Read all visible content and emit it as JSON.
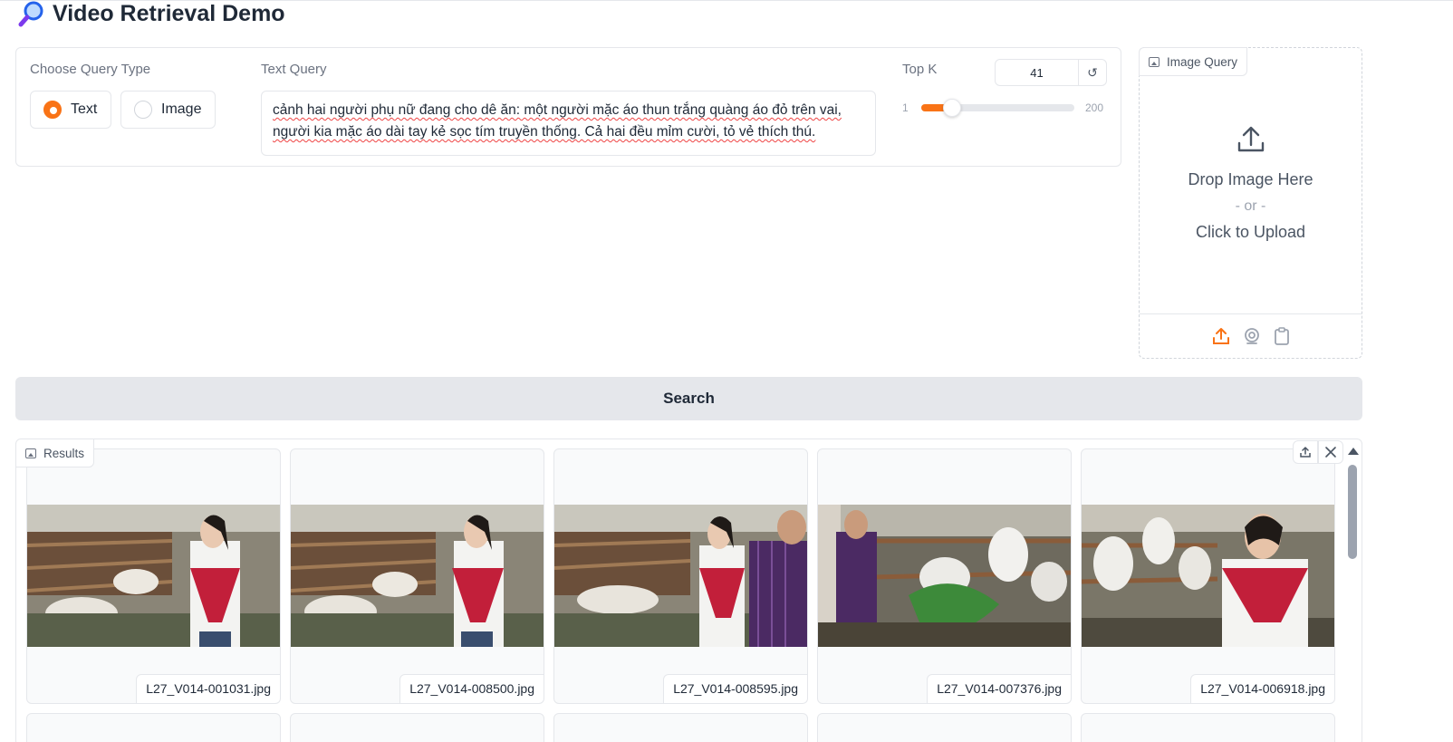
{
  "app": {
    "title": "Video Retrieval Demo",
    "title_icon": "magnifier-icon"
  },
  "query_type": {
    "label": "Choose Query Type",
    "options": [
      "Text",
      "Image"
    ],
    "selected": "Text"
  },
  "text_query": {
    "label": "Text Query",
    "value": "cảnh hai người phụ nữ đang cho dê ăn: một người mặc áo thun trắng quàng áo đỏ trên vai, người kia mặc áo dài tay kẻ sọc tím truyền thống. Cả hai đều mỉm cười, tỏ vẻ thích thú."
  },
  "top_k": {
    "label": "Top K",
    "value": "41",
    "min": "1",
    "max": "200",
    "reset_icon": "reset-icon"
  },
  "image_query": {
    "label": "Image Query",
    "drop_text": "Drop Image Here",
    "or_text": "- or -",
    "click_text": "Click to Upload",
    "sources": [
      "upload-icon",
      "webcam-icon",
      "clipboard-icon"
    ]
  },
  "search": {
    "label": "Search"
  },
  "results": {
    "label": "Results",
    "tools": [
      "share-icon",
      "close-icon"
    ],
    "items": [
      {
        "filename": "L27_V014-001031.jpg"
      },
      {
        "filename": "L27_V014-008500.jpg"
      },
      {
        "filename": "L27_V014-008595.jpg"
      },
      {
        "filename": "L27_V014-007376.jpg"
      },
      {
        "filename": "L27_V014-006918.jpg"
      }
    ]
  },
  "colors": {
    "accent": "#f97316",
    "border": "#e5e7eb",
    "button_bg": "#e5e7eb"
  }
}
